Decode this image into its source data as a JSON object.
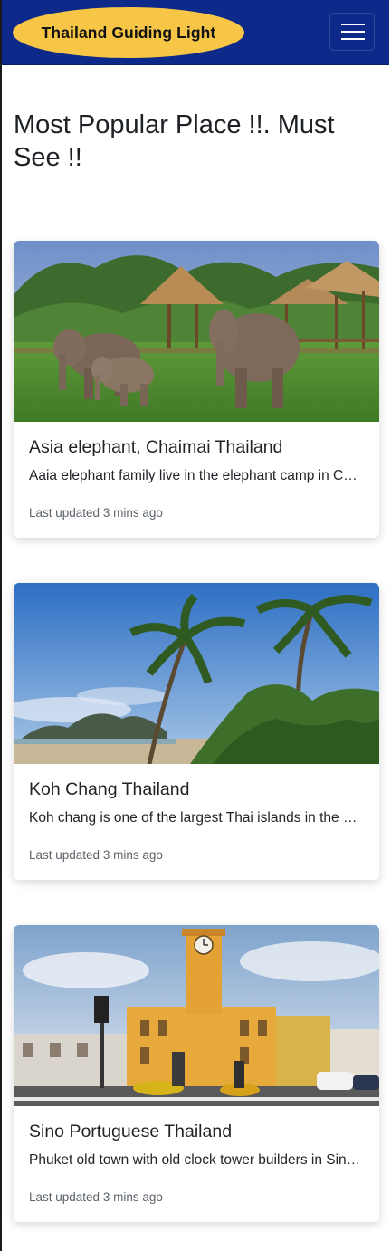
{
  "navbar": {
    "brand": "Thailand Guiding Light",
    "toggle_icon": "hamburger-menu-icon"
  },
  "main": {
    "heading": "Most Popular Place !!. Must See !!"
  },
  "cards": [
    {
      "title": "Asia elephant, Chaimai Thailand",
      "text": "Aaia elephant family live in the elephant camp in Chaimai Thailand",
      "meta": "Last updated 3 mins ago",
      "image": "elephant-family-photo"
    },
    {
      "title": "Koh Chang Thailand",
      "text": "Koh chang is one of the largest Thai islands in the Gulf of Thailand",
      "meta": "Last updated 3 mins ago",
      "image": "palm-beach-photo"
    },
    {
      "title": "Sino Portuguese Thailand",
      "text": "Phuket old town with old clock tower builders in Sino Portuguese style",
      "meta": "Last updated 3 mins ago",
      "image": "clock-tower-photo"
    }
  ],
  "colors": {
    "navbar_bg": "#0d2a8a",
    "brand_bg": "#f7c646"
  }
}
